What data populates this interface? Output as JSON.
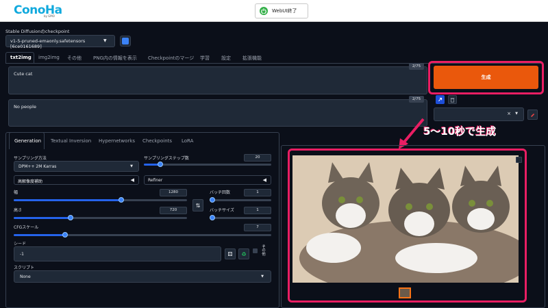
{
  "topbar": {
    "logo": "ConoHa",
    "logo_sub": "by GMO",
    "webui_exit_label": "WebUI終了"
  },
  "checkpoint": {
    "label": "Stable Diffusionのcheckpoint",
    "value": "v1-5-pruned-emaonly.safetensors [6ce0161689]"
  },
  "main_tabs": [
    "txt2img",
    "img2img",
    "その他",
    "PNG内の情報を表示",
    "Checkpointのマージ",
    "学習",
    "設定",
    "拡張機能"
  ],
  "prompts": {
    "positive": "Cute cat",
    "positive_count": "2/75",
    "negative": "No people",
    "negative_count": "2/75"
  },
  "generate_label": "生成",
  "sub_tabs": [
    "Generation",
    "Textual Inversion",
    "Hypernetworks",
    "Checkpoints",
    "LoRA"
  ],
  "params": {
    "sampler_label": "サンプリング方法",
    "sampler_value": "DPM++ 2M Karras",
    "steps_label": "サンプリングステップ数",
    "steps_value": "20",
    "hires_label": "高解像度補助",
    "refiner_label": "Refiner",
    "width_label": "幅",
    "width_value": "1280",
    "height_label": "高さ",
    "height_value": "720",
    "batch_count_label": "バッチ回数",
    "batch_count_value": "1",
    "batch_size_label": "バッチサイズ",
    "batch_size_value": "1",
    "cfg_label": "CFGスケール",
    "cfg_value": "7",
    "seed_label": "シード",
    "seed_value": "-1",
    "extra_label": "その他",
    "script_label": "スクリプト",
    "script_value": "None"
  },
  "annotation": "5〜10秒で生成",
  "colors": {
    "accent": "#ea580c",
    "highlight": "#e91e63",
    "slider": "#2563eb",
    "bg": "#0b0f19"
  },
  "sliders": {
    "steps": 0.13,
    "width": 0.62,
    "height": 0.33,
    "batch_count": 0.0,
    "batch_size": 0.0,
    "cfg": 0.2
  }
}
